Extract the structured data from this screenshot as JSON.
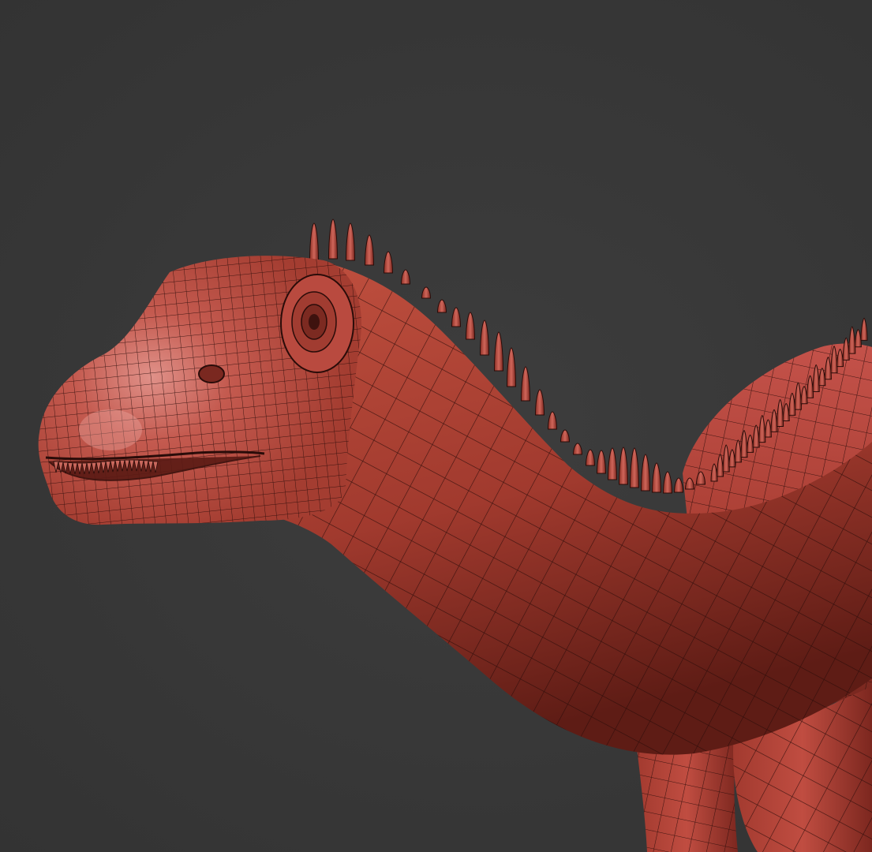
{
  "scene": {
    "background_color": "#383838",
    "model_color": "#b8473a",
    "model_shadow_color": "#6e221b",
    "model_highlight_color": "#d9837a",
    "wire_color": "#2a0c09",
    "subject": "dinosaur-head-neck-wireframe"
  }
}
